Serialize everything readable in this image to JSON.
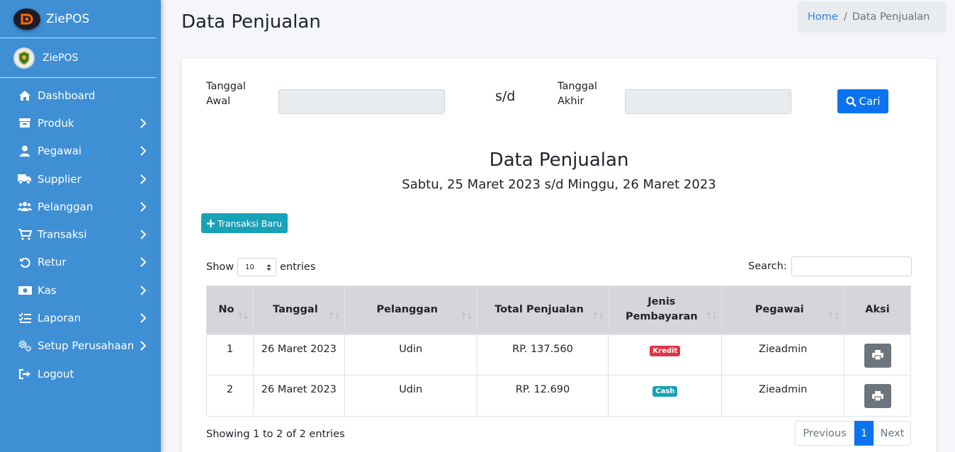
{
  "brand": {
    "name": "ZiePOS"
  },
  "user": {
    "name": "ZiePOS"
  },
  "sidebar": {
    "items": [
      {
        "label": "Dashboard",
        "icon": "home-icon",
        "has_children": false
      },
      {
        "label": "Produk",
        "icon": "box-icon",
        "has_children": true
      },
      {
        "label": "Pegawai",
        "icon": "user-icon",
        "has_children": true
      },
      {
        "label": "Supplier",
        "icon": "truck-icon",
        "has_children": true
      },
      {
        "label": "Pelanggan",
        "icon": "users-icon",
        "has_children": true
      },
      {
        "label": "Transaksi",
        "icon": "cart-icon",
        "has_children": true
      },
      {
        "label": "Retur",
        "icon": "undo-icon",
        "has_children": true
      },
      {
        "label": "Kas",
        "icon": "money-icon",
        "has_children": true
      },
      {
        "label": "Laporan",
        "icon": "list-check-icon",
        "has_children": true
      },
      {
        "label": "Setup Perusahaan",
        "icon": "gears-icon",
        "has_children": true
      },
      {
        "label": "Logout",
        "icon": "logout-icon",
        "has_children": false
      }
    ]
  },
  "header": {
    "title": "Data Penjualan",
    "breadcrumb": {
      "home": "Home",
      "separator": "/",
      "current": "Data Penjualan"
    }
  },
  "filter": {
    "start_label_1": "Tanggal",
    "start_label_2": "Awal",
    "separator": "s/d",
    "end_label_1": "Tanggal",
    "end_label_2": "Akhir",
    "search_button": "Cari"
  },
  "report": {
    "title": "Data Penjualan",
    "subtitle": "Sabtu, 25 Maret 2023 s/d Minggu, 26 Maret 2023",
    "new_button": "Transaksi Baru"
  },
  "table_controls": {
    "show_label": "Show",
    "entries_value": "10",
    "entries_label": "entries",
    "search_label": "Search:"
  },
  "table": {
    "columns": [
      "No",
      "Tanggal",
      "Pelanggan",
      "Total Penjualan",
      "Jenis Pembayaran",
      "Pegawai",
      "Aksi"
    ],
    "rows": [
      {
        "no": "1",
        "tanggal": "26 Maret 2023",
        "pelanggan": "Udin",
        "total": "RP. 137.560",
        "jenis": "Kredit",
        "jenis_color": "#dc3545",
        "pegawai": "Zieadmin"
      },
      {
        "no": "2",
        "tanggal": "26 Maret 2023",
        "pelanggan": "Udin",
        "total": "RP. 12.690",
        "jenis": "Cash",
        "jenis_color": "#17a2b8",
        "pegawai": "Zieadmin"
      }
    ]
  },
  "footer": {
    "info": "Showing 1 to 2 of 2 entries",
    "previous": "Previous",
    "page": "1",
    "next": "Next"
  },
  "colors": {
    "sidebar": "#3f8fd4",
    "primary": "#0b72f0",
    "info": "#17a2b8",
    "danger": "#dc3545",
    "secondary": "#6c757d"
  }
}
